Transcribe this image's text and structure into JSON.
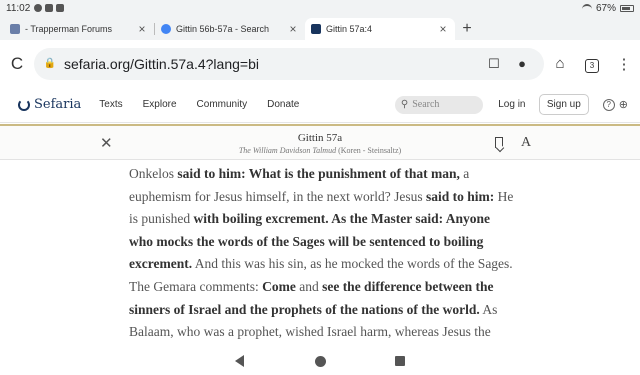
{
  "status_bar": {
    "time": "11:02",
    "battery": "67%"
  },
  "tabs": [
    {
      "title": "- Trapperman Forums",
      "favicon_color": "#6a7ea8",
      "active": false
    },
    {
      "title": "Gittin 56b-57a - Search",
      "favicon_color": "#4285f4",
      "active": false
    },
    {
      "title": "Gittin 57a:4",
      "favicon_color": "#18345d",
      "active": true
    }
  ],
  "address_bar": {
    "url": "sefaria.org/Gittin.57a.4?lang=bi",
    "tab_count": "3"
  },
  "site_nav": {
    "logo": "Sefaria",
    "links": [
      "Texts",
      "Explore",
      "Community",
      "Donate"
    ],
    "search_placeholder": "Search",
    "login": "Log in",
    "signup": "Sign up"
  },
  "reader_header": {
    "title": "Gittin 57a",
    "subtitle_italic": "The William Davidson Talmud",
    "subtitle_plain": " (Koren - Steinsaltz)",
    "font_button": "A"
  },
  "text": {
    "p1": "Onkelos ",
    "p2": "said to him: What is the punishment of that man,",
    "p3": " a euphemism for Jesus himself, in the next world? Jesus ",
    "p4": "said to him:",
    "p5": " He is punished ",
    "p6": "with boiling excrement. As the Master said: Anyone who mocks the words of the Sages will be sentenced to boiling excrement.",
    "p7": " And this was his sin, as he mocked the words of the Sages. The Gemara comments: ",
    "p8": "Come",
    "p9": " and ",
    "p10": "see the difference between the sinners of Israel and the prophets of the nations of the world.",
    "p11": " As Balaam, who was a prophet, wished Israel harm, whereas Jesus the Nazarene, who was of Israel, sought their well-being."
  },
  "colors": {
    "accent_bar": "#cbba83",
    "logo": "#18345d"
  }
}
